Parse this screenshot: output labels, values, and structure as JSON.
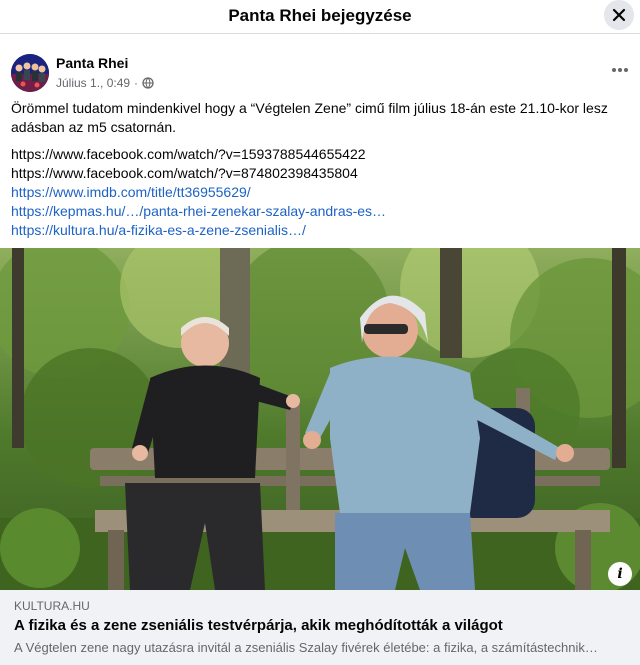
{
  "dialog": {
    "title": "Panta Rhei bejegyzése",
    "close_icon": "close-icon"
  },
  "post": {
    "author": "Panta Rhei",
    "time": "Július 1., 0:49",
    "separator": "·",
    "audience_icon": "globe-icon",
    "more_icon": "more-options-icon",
    "text": "Örömmel tudatom mindenkivel hogy a “Végtelen Zene” cimű film július 18-án este 21.10-kor lesz adásban az m5 csatornán.",
    "links": [
      {
        "text": "https://www.facebook.com/watch/?v=1593788544655422",
        "style": "plain"
      },
      {
        "text": "https://www.facebook.com/watch/?v=874802398435804",
        "style": "plain"
      },
      {
        "text": "https://www.imdb.com/title/tt36955629/",
        "style": "blue"
      },
      {
        "text": "https://kepmas.hu/…/panta-rhei-zenekar-szalay-andras-es…",
        "style": "blue"
      },
      {
        "text": "https://kultura.hu/a-fizika-es-a-zene-zsenialis…/",
        "style": "blue"
      }
    ]
  },
  "link_preview": {
    "source": "KULTURA.HU",
    "title": "A fizika és a zene zseniális testvérpárja, akik meghódították a világot",
    "description": "A Végtelen zene nagy utazásra invitál a zseniális Szalay fivérek életébe: a fizika, a számítástechnik…",
    "info_icon": "info-icon",
    "info_glyph": "i"
  },
  "colors": {
    "link_blue": "#1d62c5",
    "secondary_text": "#65676b",
    "preview_bg": "#f0f2f5"
  }
}
